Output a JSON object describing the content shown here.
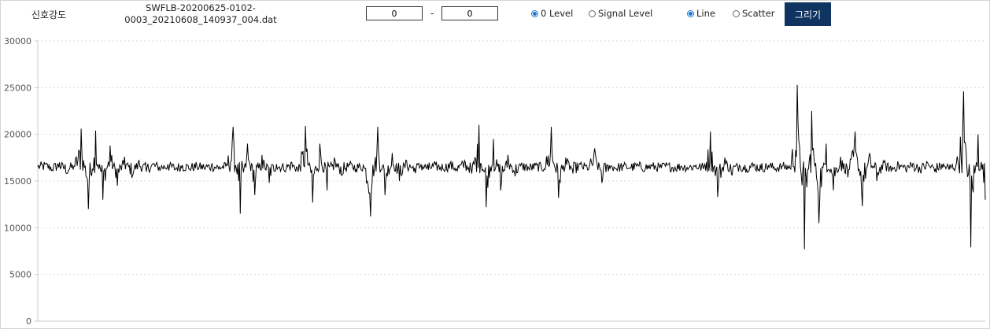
{
  "toolbar": {
    "title_label": "신호강도",
    "file_name_line1": "SWFLB-20200625-0102-",
    "file_name_line2": "0003_20210608_140937_004.dat",
    "range_start": "0",
    "range_separator": "-",
    "range_end": "0",
    "level_options": [
      {
        "label": "0 Level",
        "checked": true
      },
      {
        "label": "Signal Level",
        "checked": false
      }
    ],
    "plot_options": [
      {
        "label": "Line",
        "checked": true
      },
      {
        "label": "Scatter",
        "checked": false
      }
    ],
    "draw_button_label": "그리기",
    "accent_color": "#1976d2",
    "button_color": "#0f3460"
  },
  "chart_data": {
    "type": "line",
    "title": "",
    "xlabel": "",
    "ylabel": "",
    "ylim": [
      0,
      30000
    ],
    "yticks": [
      0,
      5000,
      10000,
      15000,
      20000,
      25000,
      30000
    ],
    "ytick_labels": [
      "0",
      "5000",
      "10000",
      "15000",
      "20000",
      "25000",
      "30000"
    ],
    "grid": true,
    "line_color": "#000000",
    "series": [
      {
        "baseline": 16500,
        "values": [
          16500,
          16800,
          16200,
          17000,
          15800,
          16600,
          20600,
          12000,
          20400,
          13000,
          18800,
          14500,
          17600,
          15400,
          17200,
          16000,
          16900,
          16300,
          16800,
          16200,
          16700,
          16300,
          16600,
          16400,
          16700,
          16300,
          16600,
          20800,
          11500,
          19000,
          13500,
          17800,
          14800,
          16800,
          16200,
          17000,
          16000,
          20900,
          12700,
          19000,
          14000,
          17500,
          15600,
          16800,
          16300,
          16700,
          11200,
          20800,
          13500,
          18000,
          15000,
          17200,
          16000,
          16800,
          16200,
          16700,
          16300,
          16900,
          16100,
          17200,
          15800,
          21000,
          12200,
          19500,
          14000,
          17800,
          15500,
          16800,
          16200,
          16700,
          16300,
          20800,
          13200,
          17500,
          15800,
          16800,
          16200,
          18500,
          14800,
          16700,
          16300,
          16600,
          16400,
          16700,
          16300,
          16600,
          16400,
          16700,
          16300,
          16600,
          16400,
          16700,
          16300,
          20300,
          13300,
          17500,
          15600,
          16700,
          16300,
          16800,
          16200,
          16700,
          16300,
          16600,
          16400,
          25300,
          7700,
          22500,
          10500,
          19000,
          14000,
          17600,
          15400,
          20300,
          12300,
          18000,
          15000,
          17000,
          16000,
          16800,
          16200,
          16900,
          16100,
          17000,
          16000,
          16800,
          16200,
          16900,
          24600,
          7900,
          20000,
          13000
        ]
      }
    ]
  }
}
